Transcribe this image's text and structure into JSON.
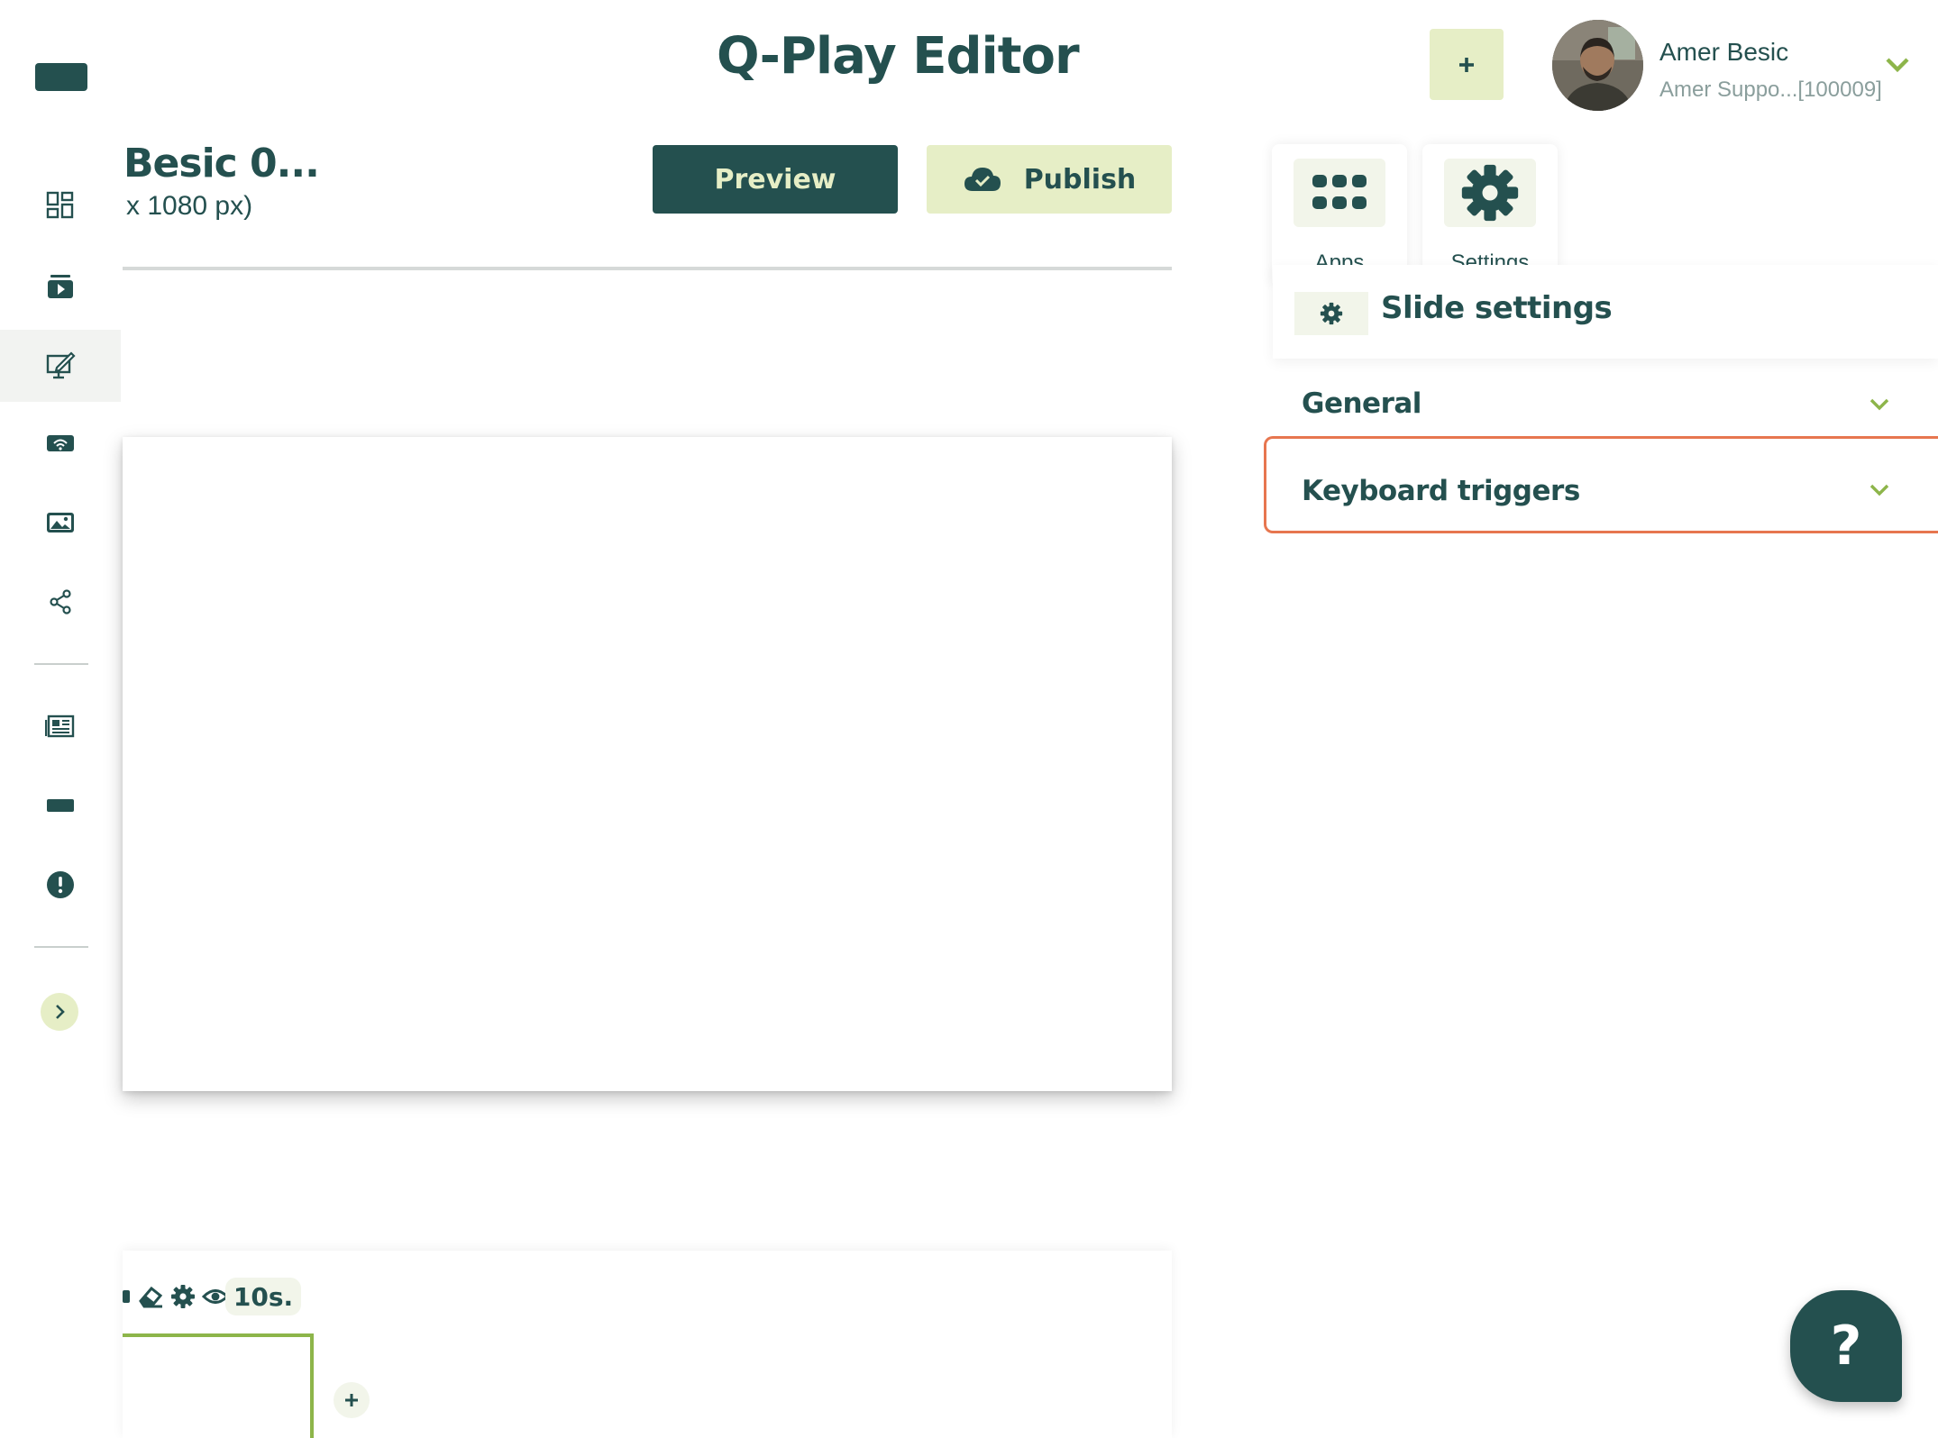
{
  "header": {
    "app_title": "Q-Play Editor",
    "add_label": "+",
    "user": {
      "name": "Amer Besic",
      "org": "Amer Suppo...[100009]"
    }
  },
  "sidebar": {
    "items": [
      {
        "icon": "dashboard-icon"
      },
      {
        "icon": "media-player-icon"
      },
      {
        "icon": "editor-icon",
        "active": true
      },
      {
        "icon": "wifi-device-icon"
      },
      {
        "icon": "image-gallery-icon"
      },
      {
        "icon": "share-icon"
      },
      {
        "icon": "newspaper-icon"
      },
      {
        "icon": "screen-icon"
      },
      {
        "icon": "alert-icon"
      }
    ],
    "expand_label": "›"
  },
  "editor": {
    "doc_title": "Besic 0...",
    "resolution": "x 1080 px)",
    "preview_label": "Preview",
    "publish_label": "Publish"
  },
  "timeline": {
    "duration": "10s.",
    "add_label": "+"
  },
  "right_panel": {
    "tabs": [
      {
        "label": "Apps",
        "icon": "apps-grid-icon"
      },
      {
        "label": "Settings",
        "icon": "settings-gear-icon"
      }
    ],
    "section_title": "Slide settings",
    "accordions": [
      {
        "label": "General"
      },
      {
        "label": "Keyboard triggers",
        "highlighted": true
      }
    ]
  },
  "help_label": "?",
  "colors": {
    "primary": "#24504f",
    "accent_light": "#e6eec6",
    "accent_green": "#8db54a",
    "highlight_border": "#e7764f"
  }
}
